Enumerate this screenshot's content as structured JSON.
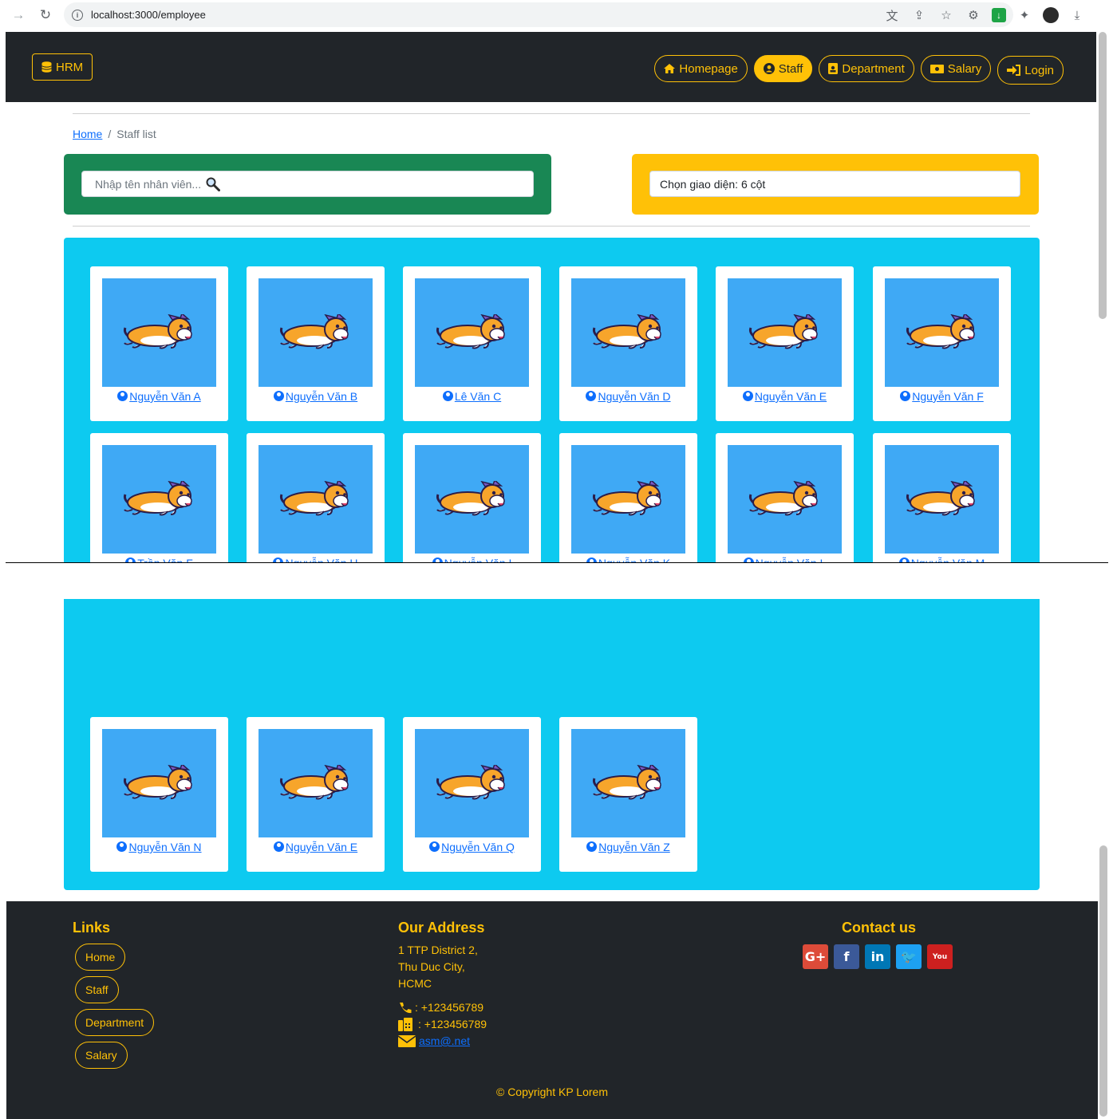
{
  "browser": {
    "url": "localhost:3000/employee"
  },
  "nav": {
    "brand": "HRM",
    "links": [
      {
        "label": "Homepage",
        "icon": "home-icon",
        "active": false
      },
      {
        "label": "Staff",
        "icon": "user-circle-icon",
        "active": true
      },
      {
        "label": "Department",
        "icon": "id-badge-icon",
        "active": false
      },
      {
        "label": "Salary",
        "icon": "money-bill-icon",
        "active": false
      },
      {
        "label": "Login",
        "icon": "sign-in-icon",
        "active": false
      }
    ]
  },
  "breadcrumb": {
    "home": "Home",
    "separator": "/",
    "current": "Staff list"
  },
  "search": {
    "placeholder": "Nhập tên nhân viên..."
  },
  "layout_select": {
    "value": "Chọn giao diện: 6 cột"
  },
  "staff": [
    "Nguyễn Văn A",
    "Nguyễn Văn B",
    "Lê Văn C",
    "Nguyễn Văn D",
    "Nguyễn Văn E",
    "Nguyễn Văn F",
    "Trần Văn F",
    "Nguyễn Văn H",
    "Nguyễn Văn I",
    "Nguyễn Văn K",
    "Nguyễn Văn L",
    "Nguyễn Văn M",
    "Nguyễn Văn N",
    "Nguyễn Văn E",
    "Nguyễn Văn Q",
    "Nguyễn Văn Z"
  ],
  "footer": {
    "links_title": "Links",
    "links": [
      "Home",
      "Staff",
      "Department",
      "Salary"
    ],
    "address_title": "Our Address",
    "address_lines": [
      "1 TTP District 2,",
      "Thu Duc City,",
      "HCMC"
    ],
    "phone": ": +123456789",
    "fax": ": +123456789",
    "email": "asm@.net",
    "contact_title": "Contact us",
    "social": [
      {
        "name": "google-plus-icon",
        "glyph": "G+",
        "color": "#dd4b39"
      },
      {
        "name": "facebook-icon",
        "glyph": "f",
        "color": "#3b5998"
      },
      {
        "name": "linkedin-icon",
        "glyph": "in",
        "color": "#0077b5"
      },
      {
        "name": "twitter-icon",
        "glyph": "🐦",
        "color": "#1da1f2"
      },
      {
        "name": "youtube-icon",
        "glyph": "You",
        "color": "#cd201f"
      }
    ],
    "copyright": "© Copyright KP Lorem"
  }
}
